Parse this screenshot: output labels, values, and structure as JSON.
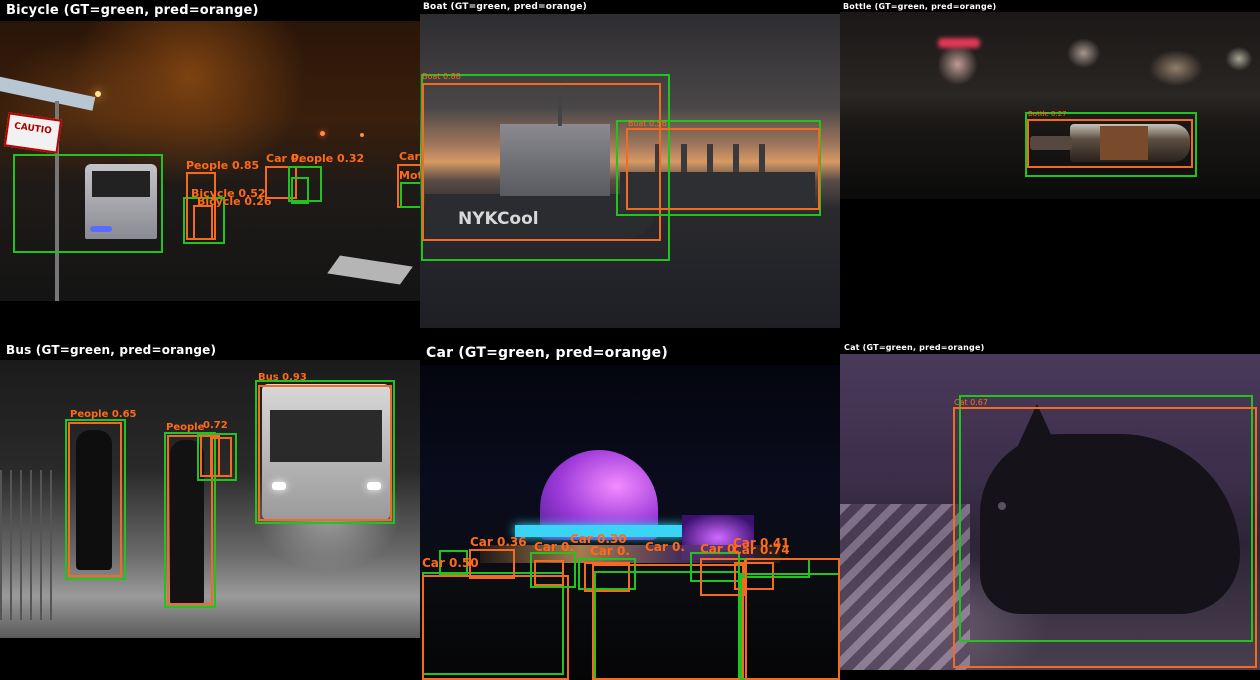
{
  "panels": {
    "bicycle": {
      "title": "Bicycle  (GT=green, pred=orange)"
    },
    "boat": {
      "title": "Boat  (GT=green, pred=orange)"
    },
    "bottle": {
      "title": "Bottle  (GT=green, pred=orange)"
    },
    "bus": {
      "title": "Bus  (GT=green, pred=orange)"
    },
    "car": {
      "title": "Car  (GT=green, pred=orange)"
    },
    "cat": {
      "title": "Cat  (GT=green, pred=orange)"
    }
  },
  "scene_text": {
    "caution_sign": "CAUTIO",
    "ship_name": "NYKCool"
  },
  "labels": {
    "bicycle": {
      "people1": "People 0.85",
      "car": "Car 0.",
      "people2": "People 0.32",
      "bicycle1": "Bicycle 0.52",
      "bicycle2": "Bicycle 0.26",
      "car_edge": "Car",
      "moto_edge": "Mot"
    },
    "boat": {
      "boat1": "Boat 0.88",
      "boat2": "Boat 0.56"
    },
    "bottle": {
      "bottle1": "Bottle 0.27"
    },
    "bus": {
      "people1": "People 0.65",
      "people2": "People",
      "people3": "0.72",
      "bus1": "Bus 0.93"
    },
    "car": {
      "car1": "Car 0.50",
      "car2": "Car 0.36",
      "car3": "Car 0.",
      "car4": "Car 0.30",
      "car5": "Car 0.",
      "car6": "Car 0.",
      "car7": "Car 0.",
      "car8": "Car 0.41",
      "car9": "Car 0.74"
    },
    "cat": {
      "cat1": "Cat 0.67"
    }
  }
}
